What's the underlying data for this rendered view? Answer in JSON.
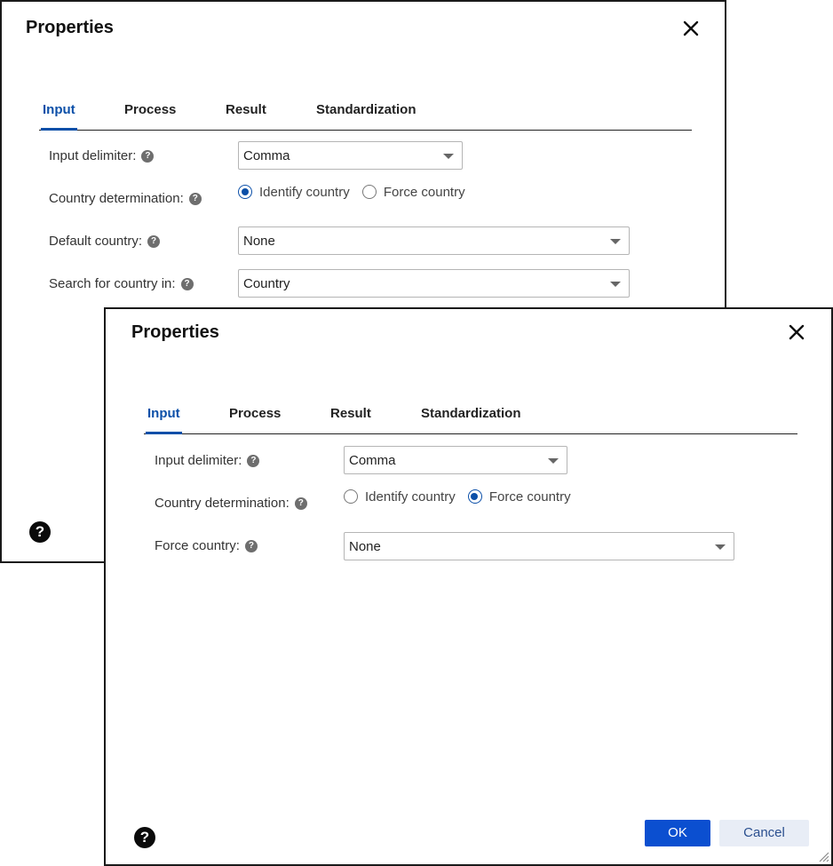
{
  "back_dialog": {
    "title": "Properties",
    "tabs": [
      "Input",
      "Process",
      "Result",
      "Standardization"
    ],
    "active_tab": "Input",
    "fields": {
      "input_delimiter": {
        "label": "Input delimiter:",
        "value": "Comma"
      },
      "country_determination": {
        "label": "Country determination:",
        "options": [
          "Identify country",
          "Force country"
        ],
        "selected": "Identify country"
      },
      "default_country": {
        "label": "Default country:",
        "value": "None"
      },
      "search_country_in": {
        "label": "Search for country in:",
        "value": "Country"
      }
    },
    "help_glyph": "?"
  },
  "front_dialog": {
    "title": "Properties",
    "tabs": [
      "Input",
      "Process",
      "Result",
      "Standardization"
    ],
    "active_tab": "Input",
    "fields": {
      "input_delimiter": {
        "label": "Input delimiter:",
        "value": "Comma"
      },
      "country_determination": {
        "label": "Country determination:",
        "options": [
          "Identify country",
          "Force country"
        ],
        "selected": "Force country"
      },
      "force_country": {
        "label": "Force country:",
        "value": "None"
      }
    },
    "buttons": {
      "ok": "OK",
      "cancel": "Cancel"
    },
    "help_glyph": "?"
  },
  "colors": {
    "accent": "#0b4fa8",
    "ok_button": "#0b4fd0",
    "cancel_bg": "#e8edf6"
  },
  "icons": [
    "close-icon",
    "help-icon",
    "dropdown-caret-icon",
    "resize-grip-icon"
  ]
}
